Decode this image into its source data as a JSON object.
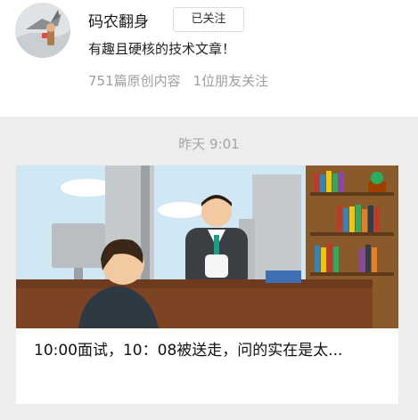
{
  "account": {
    "name": "码农翻身",
    "follow_label": "已关注",
    "description": "有趣且硬核的技术文章！",
    "stats": {
      "original_count": "751篇原创内容",
      "friends_following": "1位朋友关注"
    }
  },
  "feed": {
    "timestamp": "昨天 9:01",
    "article": {
      "title": "10:00面试，10：08被送走，问的实在是太..."
    }
  },
  "colors": {
    "background": "#ededed",
    "card": "#ffffff",
    "muted_text": "#9e9e9e"
  }
}
